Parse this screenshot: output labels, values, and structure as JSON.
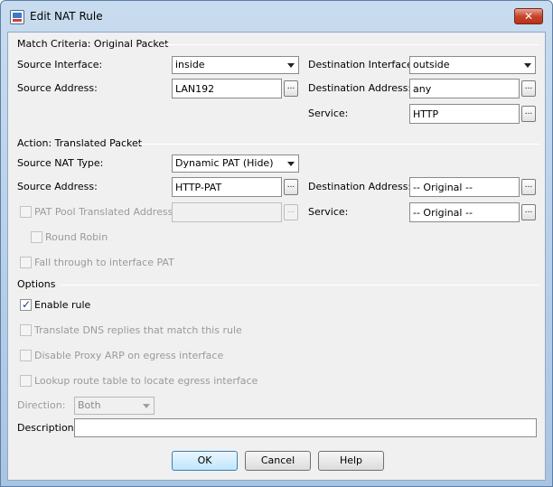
{
  "window": {
    "title": "Edit NAT Rule",
    "close_label": "✕"
  },
  "match": {
    "section_title": "Match Criteria: Original Packet",
    "source_interface_label": "Source Interface:",
    "source_interface_value": "inside",
    "destination_interface_label": "Destination Interface:",
    "destination_interface_value": "outside",
    "source_address_label": "Source Address:",
    "source_address_value": "LAN192",
    "destination_address_label": "Destination Address:",
    "destination_address_value": "any",
    "service_label": "Service:",
    "service_value": "HTTP"
  },
  "action": {
    "section_title": "Action: Translated Packet",
    "nat_type_label": "Source NAT Type:",
    "nat_type_value": "Dynamic PAT (Hide)",
    "source_address_label": "Source Address:",
    "source_address_value": "HTTP-PAT",
    "destination_address_label": "Destination Address:",
    "destination_address_value": "-- Original --",
    "pat_pool_label": "PAT Pool Translated Address:",
    "pat_pool_value": "",
    "service_label": "Service:",
    "service_value": "-- Original --",
    "round_robin_label": "Round Robin",
    "fall_through_label": "Fall through to interface PAT"
  },
  "options": {
    "section_title": "Options",
    "enable_rule_label": "Enable rule",
    "enable_rule_checked": true,
    "translate_dns_label": "Translate DNS replies that match this rule",
    "disable_proxy_arp_label": "Disable Proxy ARP on egress interface",
    "lookup_route_label": "Lookup route table to locate egress interface",
    "direction_label": "Direction:",
    "direction_value": "Both",
    "description_label": "Description:",
    "description_value": ""
  },
  "buttons": {
    "ok": "OK",
    "cancel": "Cancel",
    "help": "Help",
    "browse": "..."
  }
}
